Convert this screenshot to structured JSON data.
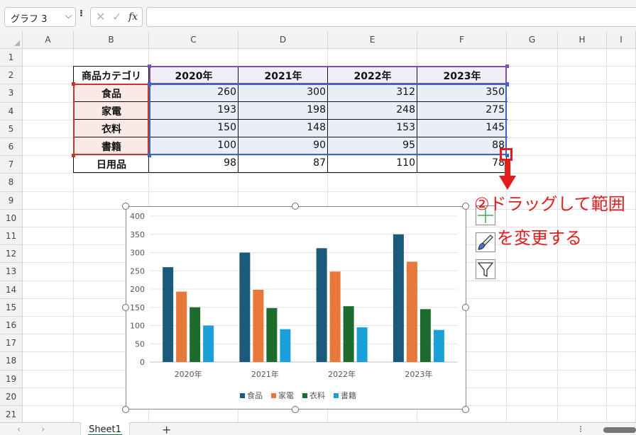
{
  "formula_bar": {
    "name_box": "グラフ 3",
    "name_dropdown": "⌵",
    "menu_dots": "⁝",
    "cancel_icon": "✕",
    "enter_icon": "✓",
    "fx_label": "fx",
    "formula_value": ""
  },
  "columns": [
    "A",
    "B",
    "C",
    "D",
    "E",
    "F",
    "G",
    "H",
    "I"
  ],
  "rows": [
    "1",
    "2",
    "3",
    "4",
    "5",
    "6",
    "7",
    "8",
    "9",
    "10",
    "11",
    "12",
    "13",
    "14",
    "15",
    "16",
    "17",
    "18",
    "19",
    "20",
    "21"
  ],
  "table": {
    "header": [
      "商品カテゴリ",
      "2020年",
      "2021年",
      "2022年",
      "2023年"
    ],
    "rows": [
      {
        "cat": "食品",
        "v": [
          "260",
          "300",
          "312",
          "350"
        ]
      },
      {
        "cat": "家電",
        "v": [
          "193",
          "198",
          "248",
          "275"
        ]
      },
      {
        "cat": "衣料",
        "v": [
          "150",
          "148",
          "153",
          "145"
        ]
      },
      {
        "cat": "書籍",
        "v": [
          "100",
          "90",
          "95",
          "88"
        ]
      },
      {
        "cat": "日用品",
        "v": [
          "98",
          "87",
          "110",
          "78"
        ]
      }
    ]
  },
  "annotation": {
    "line1": "②ドラッグして範囲",
    "line2": "を変更する"
  },
  "chart_side_buttons": [
    "chart-elements",
    "chart-styles",
    "chart-filters"
  ],
  "chart_data": {
    "type": "bar",
    "categories": [
      "2020年",
      "2021年",
      "2022年",
      "2023年"
    ],
    "series": [
      {
        "name": "食品",
        "values": [
          260,
          300,
          312,
          350
        ],
        "color": "#1a5a7a"
      },
      {
        "name": "家電",
        "values": [
          193,
          198,
          248,
          275
        ],
        "color": "#e8773a"
      },
      {
        "name": "衣料",
        "values": [
          150,
          148,
          153,
          145
        ],
        "color": "#1e6b2e"
      },
      {
        "name": "書籍",
        "values": [
          100,
          90,
          95,
          88
        ],
        "color": "#1aa0d8"
      }
    ],
    "yticks": [
      "0",
      "50",
      "100",
      "150",
      "200",
      "250",
      "300",
      "350",
      "400"
    ],
    "ylim": [
      0,
      400
    ],
    "grid": true,
    "legend": "bottom"
  },
  "sheet_tabs": {
    "prev": "‹",
    "next": "›",
    "active": "Sheet1",
    "add": "+",
    "menu_dots": "⁝"
  },
  "colors": {
    "header_selection": "#7f4fb3",
    "category_selection": "#c0392b",
    "data_selection": "#3a66c4",
    "annotation": "#e31c1c"
  }
}
